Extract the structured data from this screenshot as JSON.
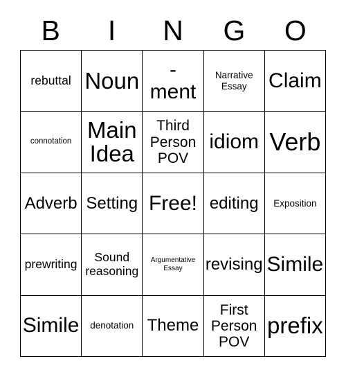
{
  "card": {
    "title": "BINGO",
    "free_space_label": "Free!",
    "background_color": "#ffffff",
    "text_color": "#000000",
    "border_color": "#000000",
    "columns": 5,
    "rows": 5
  },
  "header": {
    "letters": [
      "B",
      "I",
      "N",
      "G",
      "O"
    ]
  },
  "grid": {
    "rows": [
      {
        "cells": [
          {
            "text": "rebuttal",
            "size": "lg",
            "free": false
          },
          {
            "text": "Noun",
            "size": "4xl",
            "free": false
          },
          {
            "text": "-\nment",
            "size": "3xl",
            "free": false
          },
          {
            "text": "Narrative\nEssay",
            "size": "md",
            "free": false
          },
          {
            "text": "Claim",
            "size": "3xl",
            "free": false
          }
        ]
      },
      {
        "cells": [
          {
            "text": "connotation",
            "size": "sm",
            "free": false
          },
          {
            "text": "Main\nIdea",
            "size": "4xl",
            "free": false
          },
          {
            "text": "Third\nPerson\nPOV",
            "size": "xl",
            "free": false
          },
          {
            "text": "idiom",
            "size": "3xl",
            "free": false
          },
          {
            "text": "Verb",
            "size": "5xl",
            "free": false
          }
        ]
      },
      {
        "cells": [
          {
            "text": "Adverb",
            "size": "2xl",
            "free": false
          },
          {
            "text": "Setting",
            "size": "2xl",
            "free": false
          },
          {
            "text": "Free!",
            "size": "3xl",
            "free": true
          },
          {
            "text": "editing",
            "size": "2xl",
            "free": false
          },
          {
            "text": "Exposition",
            "size": "md",
            "free": false
          }
        ]
      },
      {
        "cells": [
          {
            "text": "prewriting",
            "size": "lg",
            "free": false
          },
          {
            "text": "Sound\nreasoning",
            "size": "lg",
            "free": false
          },
          {
            "text": "Argumentative\nEssay",
            "size": "xs",
            "free": false
          },
          {
            "text": "revising",
            "size": "2xl",
            "free": false
          },
          {
            "text": "Simile",
            "size": "3xl",
            "free": false
          }
        ]
      },
      {
        "cells": [
          {
            "text": "Simile",
            "size": "3xl",
            "free": false
          },
          {
            "text": "denotation",
            "size": "md",
            "free": false
          },
          {
            "text": "Theme",
            "size": "2xl",
            "free": false
          },
          {
            "text": "First\nPerson\nPOV",
            "size": "xl",
            "free": false
          },
          {
            "text": "prefix",
            "size": "4xl",
            "free": false
          }
        ]
      }
    ]
  }
}
